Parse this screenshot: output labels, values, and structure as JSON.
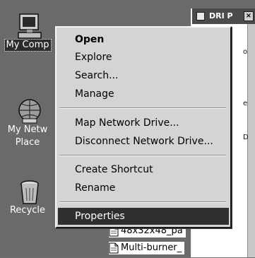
{
  "desktop": {
    "icons": [
      {
        "label": "My Comp",
        "selected": true,
        "icon": "my-computer-icon"
      },
      {
        "label": "My Netw",
        "label2": "Place",
        "icon": "my-network-places-icon"
      },
      {
        "label": "Recycle",
        "icon": "recycle-bin-icon"
      }
    ]
  },
  "background_window": {
    "title": "DRI P",
    "close_glyph": "×",
    "strip_texts": [
      "o",
      "e",
      "D"
    ]
  },
  "file_list": [
    {
      "name": "48x32x48_pa",
      "icon": "document-icon"
    },
    {
      "name": "Multi-burner_",
      "icon": "document-icon"
    }
  ],
  "context_menu": {
    "items": [
      {
        "label": "Open",
        "bold": true
      },
      {
        "label": "Explore"
      },
      {
        "label": "Search..."
      },
      {
        "label": "Manage"
      },
      {
        "separator": true
      },
      {
        "label": "Map Network Drive..."
      },
      {
        "label": "Disconnect Network Drive..."
      },
      {
        "separator": true
      },
      {
        "label": "Create Shortcut"
      },
      {
        "label": "Rename"
      },
      {
        "separator": true
      },
      {
        "label": "Properties",
        "highlighted": true
      }
    ]
  },
  "colors": {
    "desktop": "#6a6a6a",
    "menu_bg": "#d4d4d4",
    "highlight": "#2f2f2f",
    "title_bar": "#4b4b4b"
  }
}
